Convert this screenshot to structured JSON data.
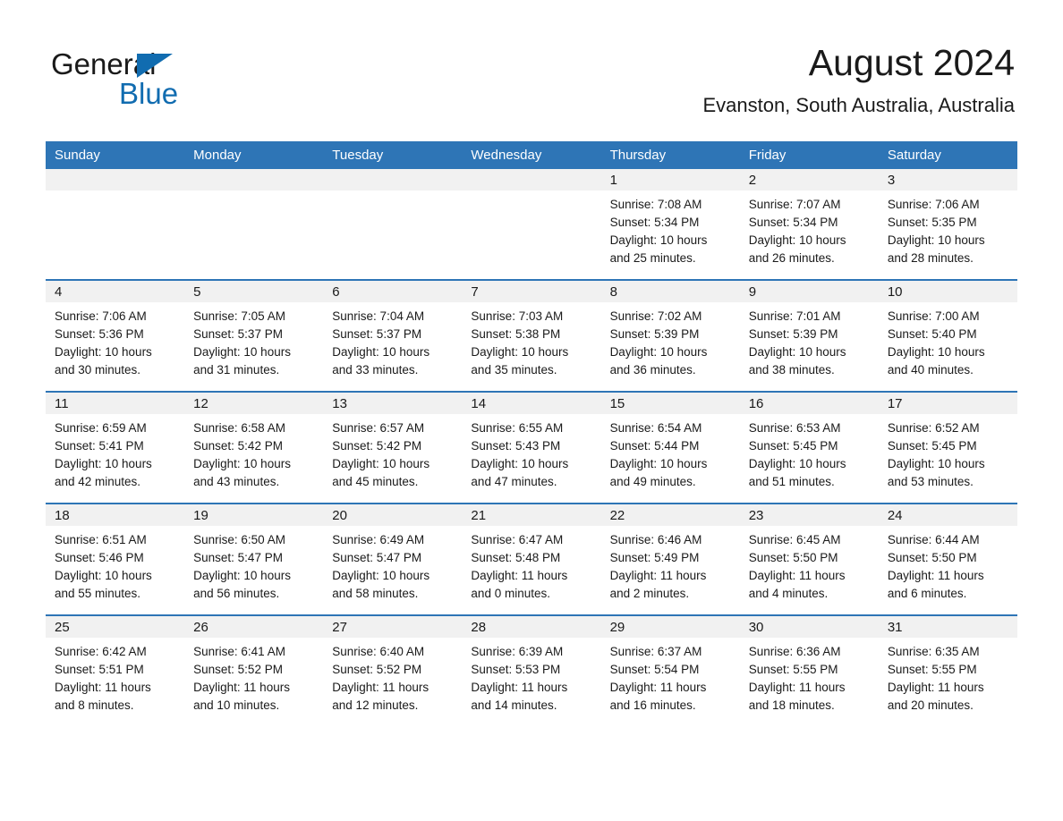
{
  "brand": {
    "name_part1": "General",
    "name_part2": "Blue",
    "triangle_color": "#116cb0",
    "blue_color": "#116cb0"
  },
  "header": {
    "month_title": "August 2024",
    "location": "Evanston, South Australia, Australia"
  },
  "theme": {
    "header_blue": "#2e75b6",
    "daynum_band": "#f1f1f1",
    "text": "#1a1a1a"
  },
  "weekday_headers": [
    "Sunday",
    "Monday",
    "Tuesday",
    "Wednesday",
    "Thursday",
    "Friday",
    "Saturday"
  ],
  "weeks": [
    [
      {
        "day": "",
        "sunrise": "",
        "sunset": "",
        "daylight1": "",
        "daylight2": ""
      },
      {
        "day": "",
        "sunrise": "",
        "sunset": "",
        "daylight1": "",
        "daylight2": ""
      },
      {
        "day": "",
        "sunrise": "",
        "sunset": "",
        "daylight1": "",
        "daylight2": ""
      },
      {
        "day": "",
        "sunrise": "",
        "sunset": "",
        "daylight1": "",
        "daylight2": ""
      },
      {
        "day": "1",
        "sunrise": "Sunrise: 7:08 AM",
        "sunset": "Sunset: 5:34 PM",
        "daylight1": "Daylight: 10 hours",
        "daylight2": "and 25 minutes."
      },
      {
        "day": "2",
        "sunrise": "Sunrise: 7:07 AM",
        "sunset": "Sunset: 5:34 PM",
        "daylight1": "Daylight: 10 hours",
        "daylight2": "and 26 minutes."
      },
      {
        "day": "3",
        "sunrise": "Sunrise: 7:06 AM",
        "sunset": "Sunset: 5:35 PM",
        "daylight1": "Daylight: 10 hours",
        "daylight2": "and 28 minutes."
      }
    ],
    [
      {
        "day": "4",
        "sunrise": "Sunrise: 7:06 AM",
        "sunset": "Sunset: 5:36 PM",
        "daylight1": "Daylight: 10 hours",
        "daylight2": "and 30 minutes."
      },
      {
        "day": "5",
        "sunrise": "Sunrise: 7:05 AM",
        "sunset": "Sunset: 5:37 PM",
        "daylight1": "Daylight: 10 hours",
        "daylight2": "and 31 minutes."
      },
      {
        "day": "6",
        "sunrise": "Sunrise: 7:04 AM",
        "sunset": "Sunset: 5:37 PM",
        "daylight1": "Daylight: 10 hours",
        "daylight2": "and 33 minutes."
      },
      {
        "day": "7",
        "sunrise": "Sunrise: 7:03 AM",
        "sunset": "Sunset: 5:38 PM",
        "daylight1": "Daylight: 10 hours",
        "daylight2": "and 35 minutes."
      },
      {
        "day": "8",
        "sunrise": "Sunrise: 7:02 AM",
        "sunset": "Sunset: 5:39 PM",
        "daylight1": "Daylight: 10 hours",
        "daylight2": "and 36 minutes."
      },
      {
        "day": "9",
        "sunrise": "Sunrise: 7:01 AM",
        "sunset": "Sunset: 5:39 PM",
        "daylight1": "Daylight: 10 hours",
        "daylight2": "and 38 minutes."
      },
      {
        "day": "10",
        "sunrise": "Sunrise: 7:00 AM",
        "sunset": "Sunset: 5:40 PM",
        "daylight1": "Daylight: 10 hours",
        "daylight2": "and 40 minutes."
      }
    ],
    [
      {
        "day": "11",
        "sunrise": "Sunrise: 6:59 AM",
        "sunset": "Sunset: 5:41 PM",
        "daylight1": "Daylight: 10 hours",
        "daylight2": "and 42 minutes."
      },
      {
        "day": "12",
        "sunrise": "Sunrise: 6:58 AM",
        "sunset": "Sunset: 5:42 PM",
        "daylight1": "Daylight: 10 hours",
        "daylight2": "and 43 minutes."
      },
      {
        "day": "13",
        "sunrise": "Sunrise: 6:57 AM",
        "sunset": "Sunset: 5:42 PM",
        "daylight1": "Daylight: 10 hours",
        "daylight2": "and 45 minutes."
      },
      {
        "day": "14",
        "sunrise": "Sunrise: 6:55 AM",
        "sunset": "Sunset: 5:43 PM",
        "daylight1": "Daylight: 10 hours",
        "daylight2": "and 47 minutes."
      },
      {
        "day": "15",
        "sunrise": "Sunrise: 6:54 AM",
        "sunset": "Sunset: 5:44 PM",
        "daylight1": "Daylight: 10 hours",
        "daylight2": "and 49 minutes."
      },
      {
        "day": "16",
        "sunrise": "Sunrise: 6:53 AM",
        "sunset": "Sunset: 5:45 PM",
        "daylight1": "Daylight: 10 hours",
        "daylight2": "and 51 minutes."
      },
      {
        "day": "17",
        "sunrise": "Sunrise: 6:52 AM",
        "sunset": "Sunset: 5:45 PM",
        "daylight1": "Daylight: 10 hours",
        "daylight2": "and 53 minutes."
      }
    ],
    [
      {
        "day": "18",
        "sunrise": "Sunrise: 6:51 AM",
        "sunset": "Sunset: 5:46 PM",
        "daylight1": "Daylight: 10 hours",
        "daylight2": "and 55 minutes."
      },
      {
        "day": "19",
        "sunrise": "Sunrise: 6:50 AM",
        "sunset": "Sunset: 5:47 PM",
        "daylight1": "Daylight: 10 hours",
        "daylight2": "and 56 minutes."
      },
      {
        "day": "20",
        "sunrise": "Sunrise: 6:49 AM",
        "sunset": "Sunset: 5:47 PM",
        "daylight1": "Daylight: 10 hours",
        "daylight2": "and 58 minutes."
      },
      {
        "day": "21",
        "sunrise": "Sunrise: 6:47 AM",
        "sunset": "Sunset: 5:48 PM",
        "daylight1": "Daylight: 11 hours",
        "daylight2": "and 0 minutes."
      },
      {
        "day": "22",
        "sunrise": "Sunrise: 6:46 AM",
        "sunset": "Sunset: 5:49 PM",
        "daylight1": "Daylight: 11 hours",
        "daylight2": "and 2 minutes."
      },
      {
        "day": "23",
        "sunrise": "Sunrise: 6:45 AM",
        "sunset": "Sunset: 5:50 PM",
        "daylight1": "Daylight: 11 hours",
        "daylight2": "and 4 minutes."
      },
      {
        "day": "24",
        "sunrise": "Sunrise: 6:44 AM",
        "sunset": "Sunset: 5:50 PM",
        "daylight1": "Daylight: 11 hours",
        "daylight2": "and 6 minutes."
      }
    ],
    [
      {
        "day": "25",
        "sunrise": "Sunrise: 6:42 AM",
        "sunset": "Sunset: 5:51 PM",
        "daylight1": "Daylight: 11 hours",
        "daylight2": "and 8 minutes."
      },
      {
        "day": "26",
        "sunrise": "Sunrise: 6:41 AM",
        "sunset": "Sunset: 5:52 PM",
        "daylight1": "Daylight: 11 hours",
        "daylight2": "and 10 minutes."
      },
      {
        "day": "27",
        "sunrise": "Sunrise: 6:40 AM",
        "sunset": "Sunset: 5:52 PM",
        "daylight1": "Daylight: 11 hours",
        "daylight2": "and 12 minutes."
      },
      {
        "day": "28",
        "sunrise": "Sunrise: 6:39 AM",
        "sunset": "Sunset: 5:53 PM",
        "daylight1": "Daylight: 11 hours",
        "daylight2": "and 14 minutes."
      },
      {
        "day": "29",
        "sunrise": "Sunrise: 6:37 AM",
        "sunset": "Sunset: 5:54 PM",
        "daylight1": "Daylight: 11 hours",
        "daylight2": "and 16 minutes."
      },
      {
        "day": "30",
        "sunrise": "Sunrise: 6:36 AM",
        "sunset": "Sunset: 5:55 PM",
        "daylight1": "Daylight: 11 hours",
        "daylight2": "and 18 minutes."
      },
      {
        "day": "31",
        "sunrise": "Sunrise: 6:35 AM",
        "sunset": "Sunset: 5:55 PM",
        "daylight1": "Daylight: 11 hours",
        "daylight2": "and 20 minutes."
      }
    ]
  ]
}
